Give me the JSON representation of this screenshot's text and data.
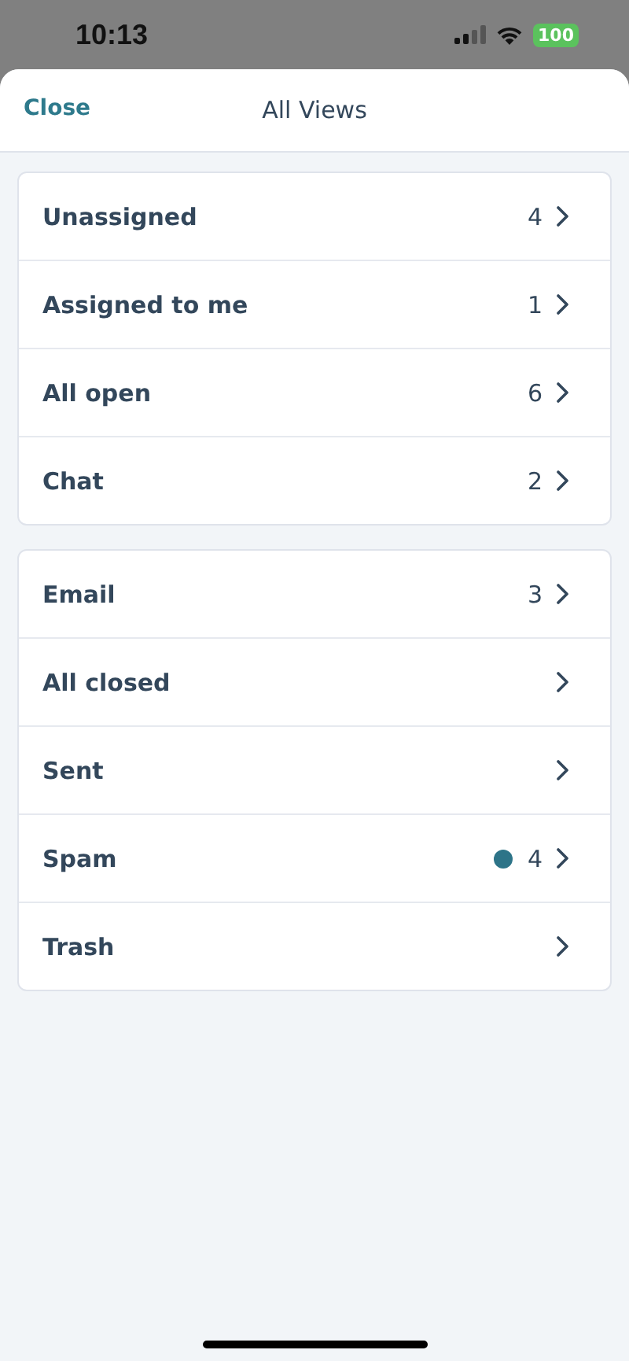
{
  "status_bar": {
    "time": "10:13",
    "battery": "100"
  },
  "header": {
    "close": "Close",
    "title": "All Views"
  },
  "groups": [
    {
      "items": [
        {
          "label": "Unassigned",
          "count": "4",
          "unread": false
        },
        {
          "label": "Assigned to me",
          "count": "1",
          "unread": false
        },
        {
          "label": "All open",
          "count": "6",
          "unread": false
        },
        {
          "label": "Chat",
          "count": "2",
          "unread": false
        }
      ]
    },
    {
      "items": [
        {
          "label": "Email",
          "count": "3",
          "unread": false
        },
        {
          "label": "All closed",
          "unread": false
        },
        {
          "label": "Sent",
          "unread": false
        },
        {
          "label": "Spam",
          "count": "4",
          "unread": true
        },
        {
          "label": "Trash",
          "unread": false
        }
      ]
    }
  ]
}
